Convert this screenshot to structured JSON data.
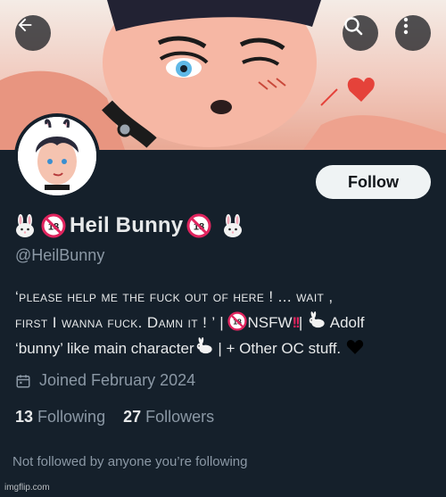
{
  "header": {
    "back_icon": "arrow-left-icon",
    "search_icon": "search-icon",
    "more_icon": "more-vertical-icon"
  },
  "profile": {
    "display_name": "Heil Bunny",
    "name_prefix_emoji": "rabbit-face-icon",
    "name_badge_icon": "no-under-18-icon",
    "handle": "@HeilBunny",
    "follow_label": "Follow"
  },
  "bio": {
    "part1": "‘please help me the fuck out of here ! ... wait ,",
    "part2": "first I wanna fuck. Damn it ! ’",
    "part3": " | ",
    "part4": "NSFW",
    "part5": "| ",
    "part6": " Adolf",
    "part7": "‘bunny’ like main character",
    "part8": " | + Other OC stuff. ",
    "icons": [
      "no-under-18-icon",
      "double-exclamation-icon",
      "rabbit-icon",
      "black-heart-icon"
    ]
  },
  "meta": {
    "calendar_icon": "calendar-icon",
    "joined": "Joined February 2024"
  },
  "stats": {
    "following_count": "13",
    "following_label": "Following",
    "followers_count": "27",
    "followers_label": "Followers"
  },
  "footer": {
    "not_followed": "Not followed by anyone you’re following",
    "watermark": "imgflip.com"
  },
  "colors": {
    "background": "#15202b",
    "secondary_text": "#8b98a5",
    "follow_button": "#eff3f4"
  }
}
